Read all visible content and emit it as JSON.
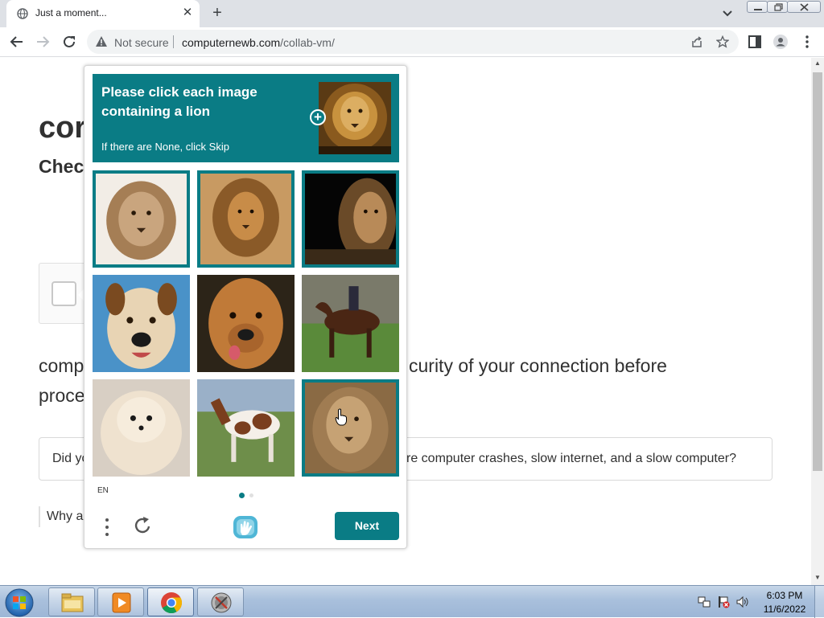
{
  "browser": {
    "tab_title": "Just a moment...",
    "security_label": "Not secure",
    "url_host": "computernewb.com",
    "url_path": "/collab-vm/"
  },
  "page": {
    "site_title_visible": "cor",
    "checking_visible": "Checl",
    "review_left": "comp",
    "review_right": "curity of your connection before",
    "review_line2": "proce",
    "tips_left": "Did yo",
    "tips_right": "re computer crashes, slow internet, and a slow computer?",
    "why_visible": "Why a"
  },
  "captcha": {
    "prompt_title": "Please click each image containing a lion",
    "prompt_subtitle": "If there are None, click Skip",
    "zoom_symbol": "+",
    "language": "EN",
    "next_label": "Next",
    "accent_color": "#0a7c85",
    "tiles": [
      {
        "subject": "lion",
        "selected": true
      },
      {
        "subject": "lion",
        "selected": true
      },
      {
        "subject": "lion",
        "selected": true
      },
      {
        "subject": "dog",
        "selected": false
      },
      {
        "subject": "dog",
        "selected": false
      },
      {
        "subject": "horse",
        "selected": false
      },
      {
        "subject": "dog",
        "selected": false
      },
      {
        "subject": "horse",
        "selected": false
      },
      {
        "subject": "lion",
        "selected": true
      }
    ],
    "page_count": 2,
    "active_page": 1
  },
  "taskbar": {
    "time": "6:03 PM",
    "date": "11/6/2022",
    "apps": [
      "explorer-icon",
      "media-player-icon",
      "chrome-icon",
      "mission-icon"
    ]
  }
}
